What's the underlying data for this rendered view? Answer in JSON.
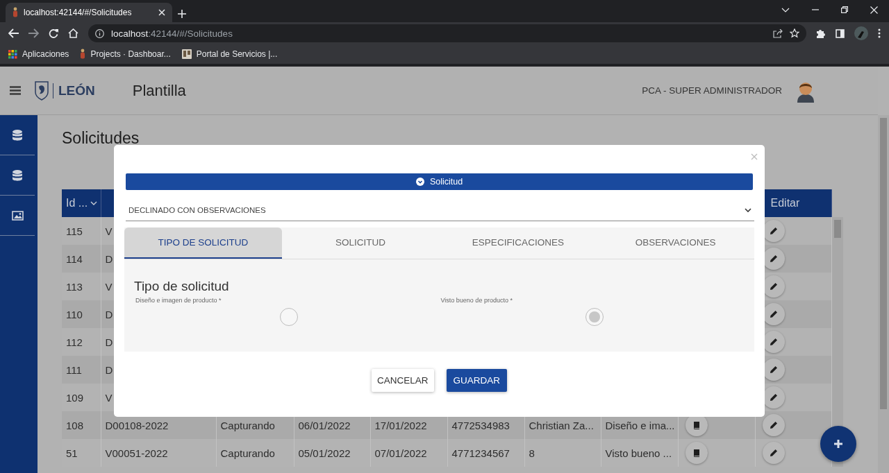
{
  "browser": {
    "tab_title": "localhost:42144/#/Solicitudes",
    "url_host": "localhost",
    "url_rest": ":42144/#/Solicitudes",
    "bookmarks": [
      {
        "label": "Aplicaciones",
        "kind": "apps"
      },
      {
        "label": "Projects · Dashboar...",
        "kind": "figure"
      },
      {
        "label": "Portal de Servicios |...",
        "kind": "doc"
      }
    ]
  },
  "header": {
    "logo_text": "LEÓN",
    "title": "Plantilla",
    "user": "PCA - SUPER ADMINISTRADOR"
  },
  "sidebar": {
    "items": [
      {
        "kind": "database"
      },
      {
        "kind": "database"
      },
      {
        "kind": "image"
      }
    ]
  },
  "page_title": "Solicitudes",
  "table": {
    "columns": [
      {
        "label": "Id ..."
      },
      {
        "label": "Editar"
      }
    ],
    "rows": [
      {
        "id": "115",
        "cells": [
          "V"
        ],
        "actions": [
          {
            "kind": "edit"
          }
        ]
      },
      {
        "id": "114",
        "cells": [
          "D"
        ],
        "actions": [
          {
            "kind": "edit"
          }
        ]
      },
      {
        "id": "113",
        "cells": [
          "V"
        ],
        "actions": [
          {
            "kind": "edit"
          }
        ]
      },
      {
        "id": "110",
        "cells": [
          "D"
        ],
        "actions": [
          {
            "kind": "edit"
          }
        ]
      },
      {
        "id": "112",
        "cells": [
          "D"
        ],
        "actions": [
          {
            "kind": "edit"
          }
        ]
      },
      {
        "id": "111",
        "cells": [
          "D"
        ],
        "actions": [
          {
            "kind": "edit"
          }
        ]
      },
      {
        "id": "109",
        "cells": [
          "V"
        ],
        "actions": [
          {
            "kind": "edit"
          }
        ]
      },
      {
        "id": "108",
        "cells": [
          "D00108-2022",
          "Capturando",
          "06/01/2022",
          "17/01/2022",
          "4772534983",
          "Christian Za...",
          "Diseño e ima..."
        ],
        "actions": [
          {
            "kind": "book"
          },
          {
            "kind": "edit"
          }
        ]
      },
      {
        "id": "51",
        "cells": [
          "V00051-2022",
          "Capturando",
          "05/01/2022",
          "07/01/2022",
          "4771234567",
          "8",
          "Visto bueno ..."
        ],
        "actions": [
          {
            "kind": "book"
          },
          {
            "kind": "edit"
          }
        ]
      }
    ]
  },
  "modal": {
    "section_title": "Solicitud",
    "status": "DECLINADO CON OBSERVACIONES",
    "tabs": [
      {
        "label": "TIPO DE SOLICITUD",
        "selected": true
      },
      {
        "label": "SOLICITUD",
        "selected": false
      },
      {
        "label": "ESPECIFICACIONES",
        "selected": false
      },
      {
        "label": "OBSERVACIONES",
        "selected": false
      }
    ],
    "panel_title": "Tipo de solicitud",
    "options": [
      {
        "label": "Diseño e imagen de producto *",
        "selected": false
      },
      {
        "label": "Visto bueno de producto *",
        "selected": true
      }
    ],
    "buttons": [
      {
        "label": "CANCELAR",
        "kind": "secondary"
      },
      {
        "label": "GUARDAR",
        "kind": "primary"
      }
    ]
  }
}
